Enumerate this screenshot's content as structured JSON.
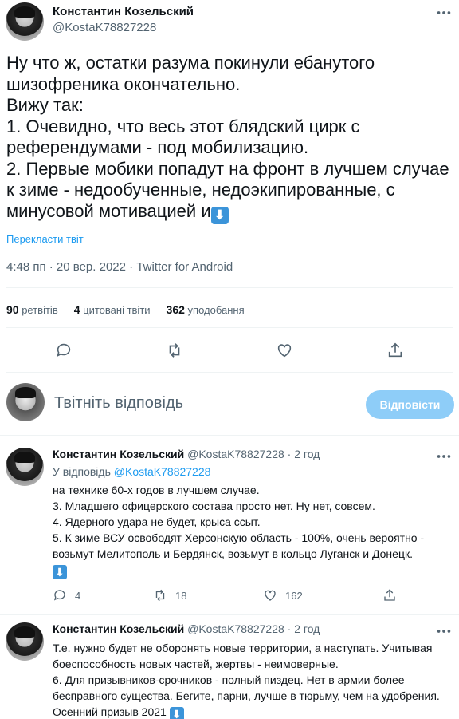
{
  "main_tweet": {
    "author_name": "Константин Козельский",
    "author_handle": "@KostaK78827228",
    "text": "Ну что ж, остатки разума покинули ебанутого шизофреника окончательно.\nВижу так:\n1. Очевидно, что весь этот блядский цирк с референдумами - под мобилизацию.\n2. Первые мобики попадут на фронт в лучшем случае к зиме - недообученные, недоэкипированные, с минусовой мотивацией и",
    "emoji": "⬇",
    "translate_label": "Перекласти твіт",
    "meta": "4:48 пп · 20 вер. 2022 · Twitter for Android",
    "stats": {
      "retweets_count": "90",
      "retweets_label": "ретвітів",
      "quotes_count": "4",
      "quotes_label": "цитовані твіти",
      "likes_count": "362",
      "likes_label": "уподобання"
    },
    "actions": [
      "reply-icon",
      "retweet-icon",
      "like-icon",
      "share-icon"
    ]
  },
  "composer": {
    "placeholder": "Твітніть відповідь",
    "reply_button": "Відповісти"
  },
  "replies": [
    {
      "author_name": "Константин Козельский",
      "author_handle": "@KostaK78827228",
      "time": "2 год",
      "replying_to_label": "У відповідь",
      "replying_to_handle": "@KostaK78827228",
      "text": "на технике 60-х годов в лучшем случае.\n3. Младшего офицерского состава просто нет. Ну нет, совсем.\n4. Ядерного удара не будет, крыса ссыт.\n5. К зиме ВСУ освободят Херсонскую область - 100%, очень вероятно - возьмут Мелитополь и Бердянск, возьмут в кольцо Луганск и Донецк.",
      "emoji": "⬇",
      "replies_count": "4",
      "retweets_count": "18",
      "likes_count": "162"
    },
    {
      "author_name": "Константин Козельский",
      "author_handle": "@KostaK78827228",
      "time": "2 год",
      "text": "Т.е. нужно будет не оборонять новые территории, а наступать. Учитывая боеспособность новых частей, жертвы - неимоверные.\n6. Для призывников-срочников - полный пиздец. Нет в армии более бесправного существа. Бегите, парни, лучше в тюрьму, чем на удобрения. Осенний призыв 2021",
      "emoji": "⬇"
    }
  ],
  "colors": {
    "accent": "#1d9bf0",
    "muted_text": "#536471",
    "reply_button_disabled": "#8ecdf8"
  }
}
